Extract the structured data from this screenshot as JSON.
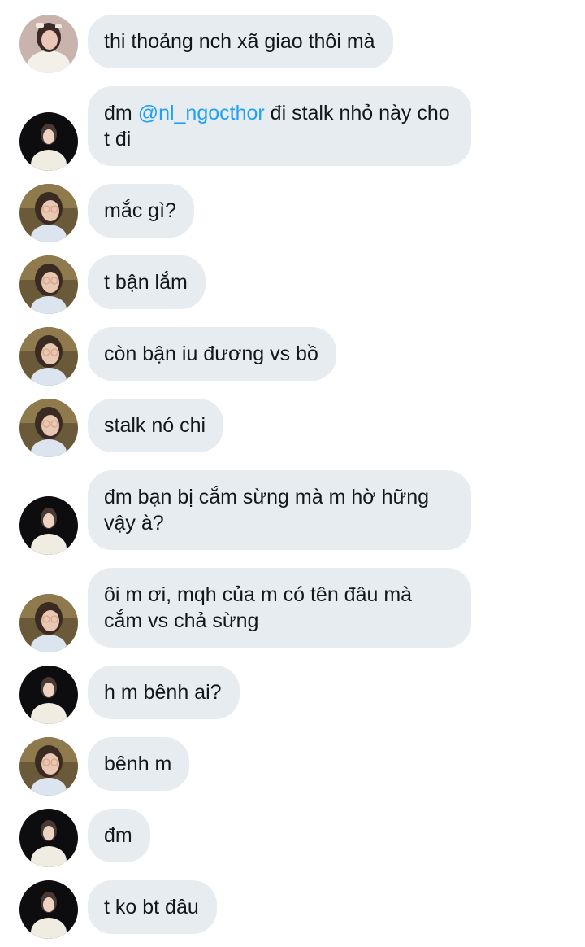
{
  "messages": [
    {
      "sender": "friend_a",
      "text": "thi thoảng nch xã giao thôi mà"
    },
    {
      "sender": "friend_b",
      "prefix": "đm ",
      "mention": "@nl_ngocthor",
      "suffix": " đi stalk nhỏ này cho t đi"
    },
    {
      "sender": "friend_c",
      "text": "mắc gì?"
    },
    {
      "sender": "friend_c",
      "text": "t bận lắm"
    },
    {
      "sender": "friend_c",
      "text": "còn bận iu đương vs bồ"
    },
    {
      "sender": "friend_c",
      "text": "stalk nó chi"
    },
    {
      "sender": "friend_b",
      "text": "đm bạn bị cắm sừng mà m hờ hững vậy à?"
    },
    {
      "sender": "friend_c",
      "text": "ôi m ơi, mqh của m có tên đâu mà cắm vs chả sừng"
    },
    {
      "sender": "friend_b",
      "text": "h m bênh ai?"
    },
    {
      "sender": "friend_c",
      "text": "bênh m"
    },
    {
      "sender": "friend_b",
      "text": "đm"
    },
    {
      "sender": "friend_b",
      "text": "t ko bt đâu"
    }
  ],
  "colors": {
    "bubble_bg": "#e6ecf0",
    "text": "#14171a",
    "mention": "#1da1f2"
  }
}
